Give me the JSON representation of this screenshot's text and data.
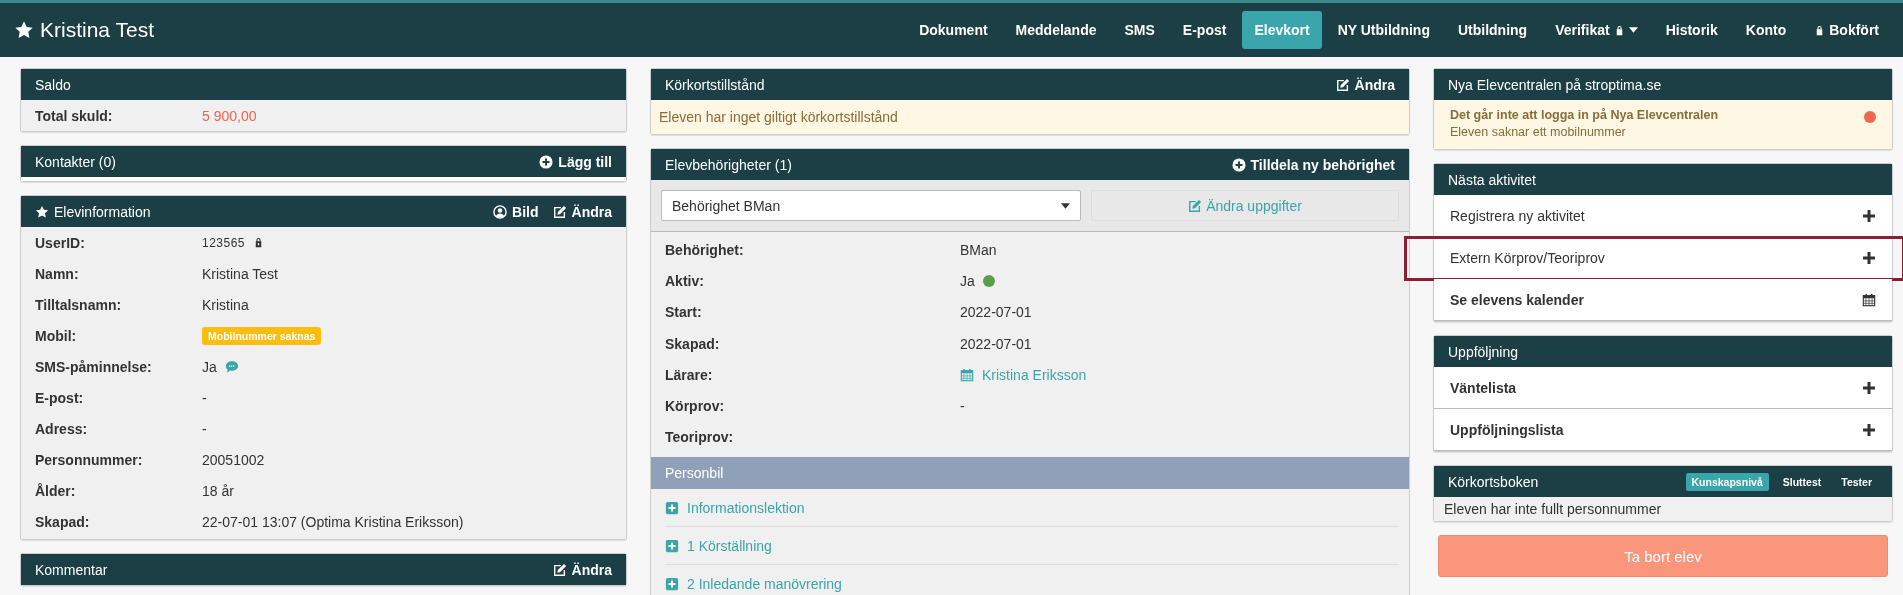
{
  "brand": {
    "title": "Kristina Test"
  },
  "nav": [
    {
      "label": "Dokument",
      "kind": "plain",
      "selected": false
    },
    {
      "label": "Meddelande",
      "kind": "plain",
      "selected": false
    },
    {
      "label": "SMS",
      "kind": "plain",
      "selected": false
    },
    {
      "label": "E-post",
      "kind": "plain",
      "selected": false
    },
    {
      "label": "Elevkort",
      "kind": "plain",
      "selected": true
    },
    {
      "label": "NY Utbildning",
      "kind": "plain",
      "selected": false
    },
    {
      "label": "Utbildning",
      "kind": "plain",
      "selected": false
    },
    {
      "label": "Verifikat",
      "kind": "menu",
      "selected": false
    },
    {
      "label": "Historik",
      "kind": "plain",
      "selected": false
    },
    {
      "label": "Konto",
      "kind": "plain",
      "selected": false
    },
    {
      "label": "Bokfört",
      "kind": "locked",
      "selected": false
    }
  ],
  "saldo": {
    "title": "Saldo",
    "rows": [
      {
        "label": "Total skuld:",
        "value": "5 900,00"
      }
    ]
  },
  "kontakter": {
    "title": "Kontakter (0)",
    "action": "Lägg till"
  },
  "elevinformation": {
    "title": "Elevinformation",
    "actions": [
      {
        "label": "Bild",
        "kind": "photo"
      },
      {
        "label": "Ändra",
        "kind": "edit"
      }
    ],
    "rows": [
      {
        "label": "UserID:",
        "value": "123565",
        "kind": "id"
      },
      {
        "label": "Namn:",
        "value": "Kristina Test",
        "kind": "text"
      },
      {
        "label": "Tilltalsnamn:",
        "value": "Kristina",
        "kind": "text"
      },
      {
        "label": "Mobil:",
        "value": "Mobilnummer saknas",
        "kind": "badge"
      },
      {
        "label": "SMS-påminnelse:",
        "value": "Ja",
        "kind": "sms"
      },
      {
        "label": "E-post:",
        "value": "-",
        "kind": "text"
      },
      {
        "label": "Adress:",
        "value": "-",
        "kind": "text"
      },
      {
        "label": "Personnummer:",
        "value": "20051002",
        "kind": "text"
      },
      {
        "label": "Ålder:",
        "value": "18 år",
        "kind": "text"
      },
      {
        "label": "Skapad:",
        "value": "22-07-01 13:07 (Optima Kristina Eriksson)",
        "kind": "text"
      }
    ]
  },
  "kommentar": {
    "title": "Kommentar",
    "action": "Ändra"
  },
  "korkortstillstand": {
    "title": "Körkortstillstånd",
    "action": "Ändra",
    "message": "Eleven har inget giltigt körkortstillstånd"
  },
  "behorigheter": {
    "title": "Elevbehörigheter (1)",
    "action": "Tilldela ny behörighet",
    "select": "Behörighet BMan",
    "button": "Ändra uppgifter",
    "rows": [
      {
        "label": "Behörighet:",
        "value": "BMan",
        "kind": "text"
      },
      {
        "label": "Aktiv:",
        "value": "Ja",
        "kind": "status",
        "on": true
      },
      {
        "label": "Start:",
        "value": "2022-07-01",
        "kind": "text"
      },
      {
        "label": "Skapad:",
        "value": "2022-07-01",
        "kind": "text"
      },
      {
        "label": "Lärare:",
        "value": "Kristina Eriksson",
        "kind": "link"
      },
      {
        "label": "Körprov:",
        "value": "-",
        "kind": "text"
      },
      {
        "label": "Teoriprov:",
        "kind": "empty"
      }
    ],
    "category": "Personbil",
    "lessons": [
      "Informationslektion",
      "1 Körställning",
      "2 Inledande manövrering"
    ]
  },
  "elevcentralen": {
    "title": "Nya Elevcentralen på stroptima.se",
    "alert_title": "Det går inte att logga in på Nya Elevcentralen",
    "alert_text": "Eleven saknar ett mobilnummer",
    "color": "#ee6650"
  },
  "nasta_aktivitet": {
    "title": "Nästa aktivitet",
    "items": [
      {
        "label": "Registrera ny aktivitet",
        "kind": "add",
        "bold": false,
        "highlighted": false
      },
      {
        "label": "Extern Körprov/Teoriprov",
        "kind": "add",
        "bold": false,
        "highlighted": true
      },
      {
        "label": "Se elevens kalender",
        "kind": "calendar",
        "bold": true,
        "highlighted": false
      }
    ]
  },
  "uppfoljning": {
    "title": "Uppföljning",
    "items": [
      {
        "label": "Väntelista",
        "kind": "add",
        "bold": true,
        "highlighted": false
      },
      {
        "label": "Uppföljningslista",
        "kind": "add",
        "bold": true,
        "highlighted": false
      }
    ]
  },
  "korkortsboken": {
    "title": "Körkortsboken",
    "tabs": [
      {
        "label": "Kunskapsnivå",
        "selected": true
      },
      {
        "label": "Sluttest",
        "selected": false
      },
      {
        "label": "Tester",
        "selected": false
      }
    ],
    "message": "Eleven har inte fullt personnummer"
  },
  "delete_button": "Ta bort elev"
}
